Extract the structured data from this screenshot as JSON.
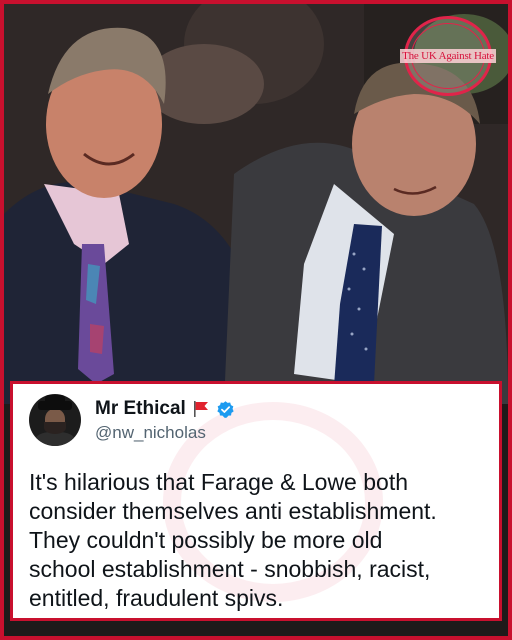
{
  "watermark": {
    "text": "The UK Against Hate",
    "brand_color": "#c8102e"
  },
  "tweet": {
    "author_name": "Mr Ethical",
    "flag_icon": "red-flag-icon",
    "verified_icon": "verified-badge-icon",
    "handle": "@nw_nicholas",
    "text_lines": [
      "It's hilarious that Farage & Lowe both",
      "consider themselves anti establishment.",
      "They couldn't possibly be more old",
      "school establishment - snobbish, racist,",
      "entitled, fraudulent spivs."
    ]
  },
  "colors": {
    "frame_border": "#c8102e",
    "verified_blue": "#1d9bf0",
    "text_primary": "#0f1419",
    "text_secondary": "#536471"
  }
}
